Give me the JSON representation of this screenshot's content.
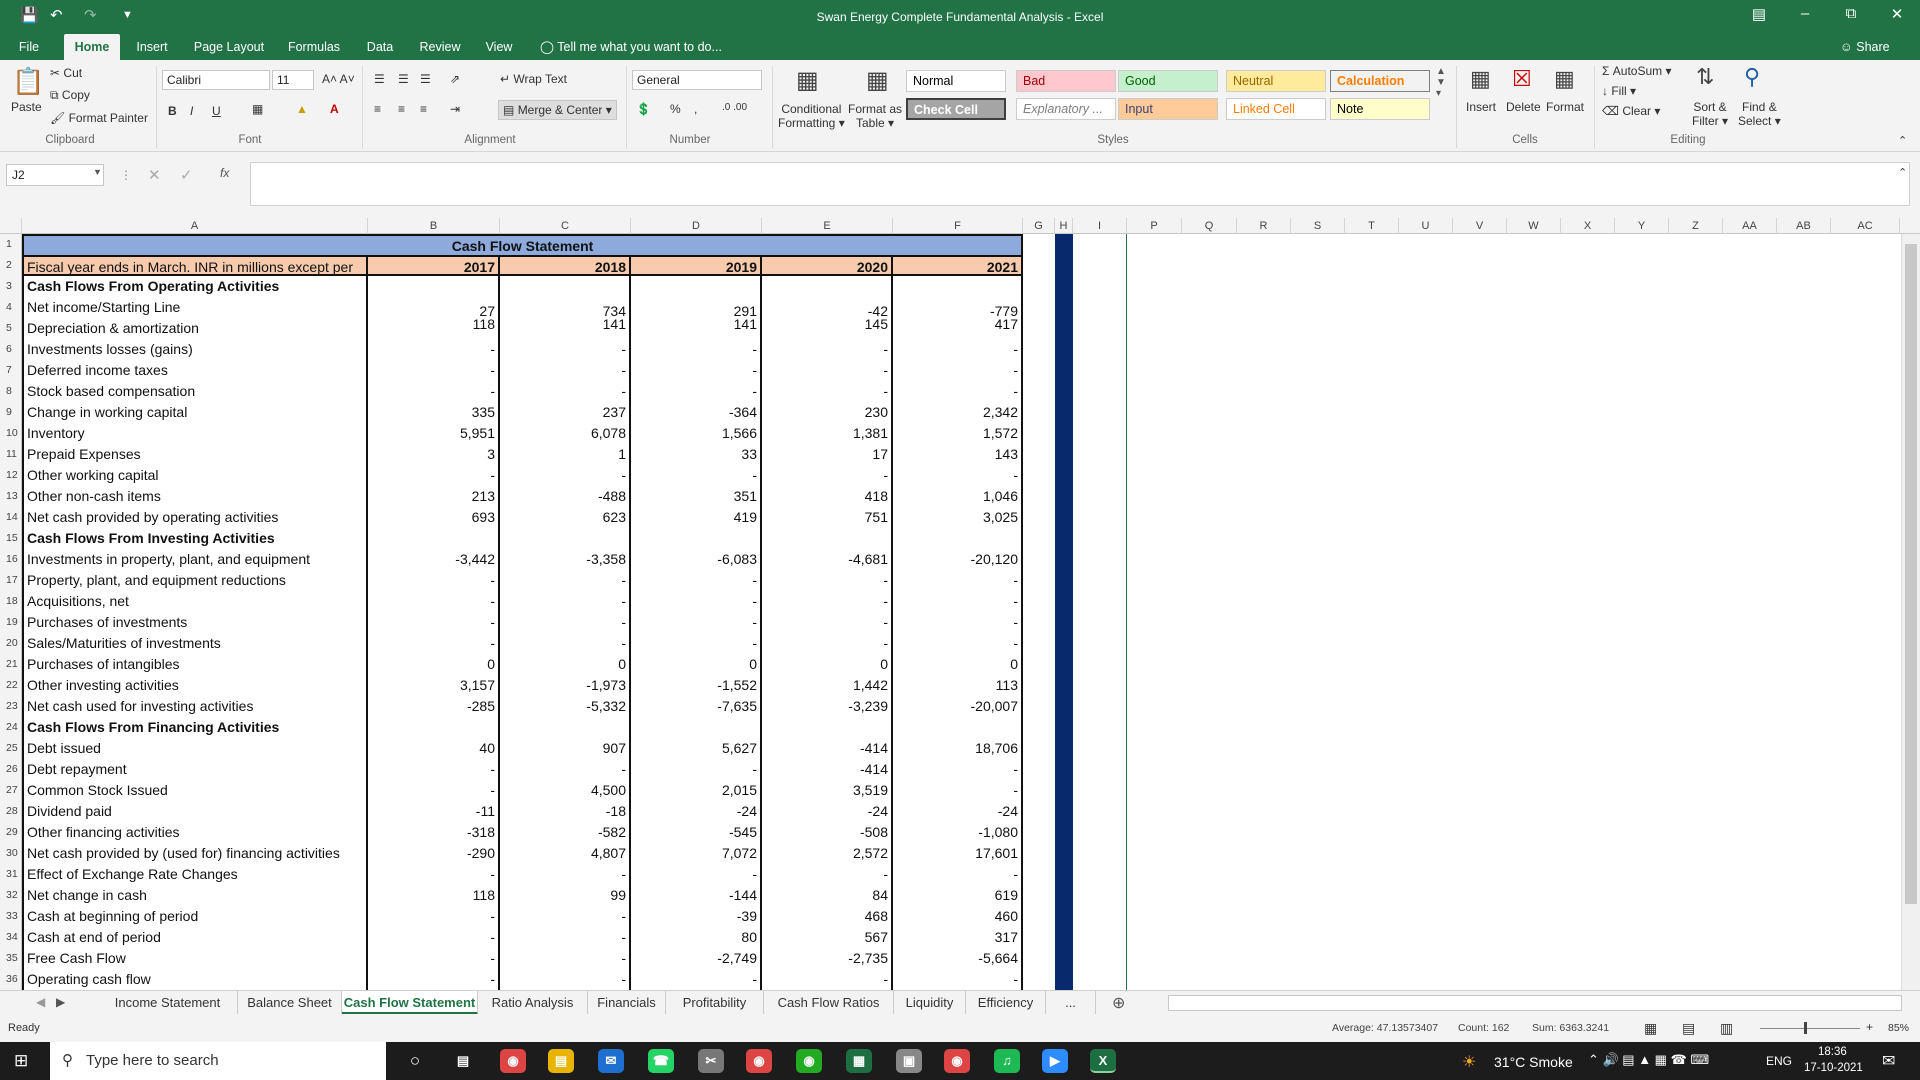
{
  "app": {
    "title": "Swan Energy Complete Fundamental Analysis - Excel",
    "share": "Share",
    "tell_me": "Tell me what you want to do..."
  },
  "menu": [
    "File",
    "Home",
    "Insert",
    "Page Layout",
    "Formulas",
    "Data",
    "Review",
    "View"
  ],
  "ribbon": {
    "paste": "Paste",
    "cut": "Cut",
    "copy": "Copy",
    "format_painter": "Format Painter",
    "clipboard": "Clipboard",
    "font_name": "Calibri",
    "font_size": "11",
    "font_group": "Font",
    "wrap_text": "Wrap Text",
    "merge_center": "Merge & Center",
    "alignment": "Alignment",
    "number_format": "General",
    "number": "Number",
    "conditional": "Conditional",
    "formatting": "Formatting",
    "format_as": "Format as",
    "table": "Table",
    "styles_group": "Styles",
    "styles": [
      {
        "label": "Normal",
        "bg": "#ffffff",
        "fg": "#000000"
      },
      {
        "label": "Bad",
        "bg": "#ffc7ce",
        "fg": "#9c0006"
      },
      {
        "label": "Good",
        "bg": "#c6efce",
        "fg": "#006100"
      },
      {
        "label": "Neutral",
        "bg": "#ffeb9c",
        "fg": "#9c6500"
      },
      {
        "label": "Calculation",
        "bg": "#f2f2f2",
        "fg": "#fa7d00"
      },
      {
        "label": "Check Cell",
        "bg": "#a5a5a5",
        "fg": "#ffffff"
      },
      {
        "label": "Explanatory ...",
        "bg": "#ffffff",
        "fg": "#7f7f7f"
      },
      {
        "label": "Input",
        "bg": "#ffcc99",
        "fg": "#3f3f76"
      },
      {
        "label": "Linked Cell",
        "bg": "#ffffff",
        "fg": "#fa7d00"
      },
      {
        "label": "Note",
        "bg": "#ffffcc",
        "fg": "#000000"
      }
    ],
    "insert": "Insert",
    "delete": "Delete",
    "format": "Format",
    "cells": "Cells",
    "autosum": "AutoSum",
    "fill": "Fill",
    "clear": "Clear",
    "sort": "Sort &",
    "filter": "Filter",
    "find": "Find &",
    "select": "Select",
    "editing": "Editing"
  },
  "formula_bar": {
    "name_box": "J2",
    "fx": "fx",
    "value": ""
  },
  "columns": [
    "A",
    "B",
    "C",
    "D",
    "E",
    "F",
    "G",
    "H",
    "I",
    "P",
    "Q",
    "R",
    "S",
    "T",
    "U",
    "V",
    "W",
    "X",
    "Y",
    "Z",
    "AA",
    "AB",
    "AC"
  ],
  "sheet": {
    "title": "Cash Flow Statement",
    "header_label": "Fiscal year ends in March. INR in millions except per",
    "years": [
      "2017",
      "2018",
      "2019",
      "2020",
      "2021"
    ],
    "rows": [
      {
        "n": "3",
        "label": "Cash Flows From Operating Activities",
        "bold": true,
        "v": [
          "",
          "",
          "",
          "",
          ""
        ]
      },
      {
        "n": "4",
        "label": "Net income/Starting Line",
        "v": [
          "27",
          "734",
          "291",
          "-42",
          "-779"
        ]
      },
      {
        "n": "5",
        "label": "Depreciation & amortization",
        "v": [
          "118",
          "141",
          "141",
          "145",
          "417"
        ]
      },
      {
        "n": "6",
        "label": "Investments losses (gains)",
        "v": [
          "-",
          "-",
          "-",
          "-",
          "-"
        ]
      },
      {
        "n": "7",
        "label": "Deferred income taxes",
        "v": [
          "-",
          "-",
          "-",
          "-",
          "-"
        ]
      },
      {
        "n": "8",
        "label": "Stock based compensation",
        "v": [
          "-",
          "-",
          "-",
          "-",
          "-"
        ]
      },
      {
        "n": "9",
        "label": "Change in working capital",
        "v": [
          "335",
          "237",
          "-364",
          "230",
          "2,342"
        ]
      },
      {
        "n": "10",
        "label": "Inventory",
        "v": [
          "5,951",
          "6,078",
          "1,566",
          "1,381",
          "1,572"
        ]
      },
      {
        "n": "11",
        "label": "Prepaid Expenses",
        "v": [
          "3",
          "1",
          "33",
          "17",
          "143"
        ]
      },
      {
        "n": "12",
        "label": "Other working capital",
        "v": [
          "-",
          "-",
          "-",
          "-",
          "-"
        ]
      },
      {
        "n": "13",
        "label": "Other non-cash items",
        "v": [
          "213",
          "-488",
          "351",
          "418",
          "1,046"
        ]
      },
      {
        "n": "14",
        "label": "Net cash provided by operating activities",
        "v": [
          "693",
          "623",
          "419",
          "751",
          "3,025"
        ]
      },
      {
        "n": "15",
        "label": "Cash Flows From Investing Activities",
        "bold": true,
        "v": [
          "",
          "",
          "",
          "",
          ""
        ]
      },
      {
        "n": "16",
        "label": "Investments in property, plant, and equipment",
        "v": [
          "-3,442",
          "-3,358",
          "-6,083",
          "-4,681",
          "-20,120"
        ]
      },
      {
        "n": "17",
        "label": "Property, plant, and equipment reductions",
        "v": [
          "-",
          "-",
          "-",
          "-",
          "-"
        ]
      },
      {
        "n": "18",
        "label": "Acquisitions, net",
        "v": [
          "-",
          "-",
          "-",
          "-",
          "-"
        ]
      },
      {
        "n": "19",
        "label": "Purchases of investments",
        "v": [
          "-",
          "-",
          "-",
          "-",
          "-"
        ]
      },
      {
        "n": "20",
        "label": "Sales/Maturities of investments",
        "v": [
          "-",
          "-",
          "-",
          "-",
          "-"
        ]
      },
      {
        "n": "21",
        "label": "Purchases of intangibles",
        "v": [
          "0",
          "0",
          "0",
          "0",
          "0"
        ]
      },
      {
        "n": "22",
        "label": "Other investing activities",
        "v": [
          "3,157",
          "-1,973",
          "-1,552",
          "1,442",
          "113"
        ]
      },
      {
        "n": "23",
        "label": "Net cash used for investing activities",
        "v": [
          "-285",
          "-5,332",
          "-7,635",
          "-3,239",
          "-20,007"
        ]
      },
      {
        "n": "24",
        "label": "Cash Flows From Financing Activities",
        "bold": true,
        "v": [
          "",
          "",
          "",
          "",
          ""
        ]
      },
      {
        "n": "25",
        "label": "Debt issued",
        "v": [
          "40",
          "907",
          "5,627",
          "-414",
          "18,706"
        ]
      },
      {
        "n": "26",
        "label": "Debt repayment",
        "v": [
          "-",
          "-",
          "-",
          "-414",
          "-"
        ]
      },
      {
        "n": "27",
        "label": "Common Stock Issued",
        "v": [
          "-",
          "4,500",
          "2,015",
          "3,519",
          "-"
        ]
      },
      {
        "n": "28",
        "label": "Dividend paid",
        "v": [
          "-11",
          "-18",
          "-24",
          "-24",
          "-24"
        ]
      },
      {
        "n": "29",
        "label": "Other financing activities",
        "v": [
          "-318",
          "-582",
          "-545",
          "-508",
          "-1,080"
        ]
      },
      {
        "n": "30",
        "label": "Net cash provided by (used for) financing activities",
        "v": [
          "-290",
          "4,807",
          "7,072",
          "2,572",
          "17,601"
        ]
      },
      {
        "n": "31",
        "label": "Effect of Exchange Rate Changes",
        "v": [
          "-",
          "-",
          "-",
          "-",
          "-"
        ]
      },
      {
        "n": "32",
        "label": "Net change in cash",
        "v": [
          "118",
          "99",
          "-144",
          "84",
          "619"
        ]
      },
      {
        "n": "33",
        "label": "Cash at beginning of period",
        "v": [
          "-",
          "-",
          "-39",
          "468",
          "460"
        ]
      },
      {
        "n": "34",
        "label": "Cash at end of period",
        "v": [
          "-",
          "-",
          "80",
          "567",
          "317"
        ]
      },
      {
        "n": "35",
        "label": "Free Cash Flow",
        "v": [
          "-",
          "-",
          "-2,749",
          "-2,735",
          "-5,664"
        ]
      },
      {
        "n": "36",
        "label": "Operating cash flow",
        "v": [
          "-",
          "-",
          "-",
          "-",
          "-"
        ]
      }
    ]
  },
  "sheet_tabs": [
    "Income Statement",
    "Balance Sheet",
    "Cash Flow Statement",
    "Ratio Analysis",
    "Financials",
    "Profitability",
    "Cash Flow Ratios",
    "Liquidity",
    "Efficiency",
    "..."
  ],
  "status": {
    "ready": "Ready",
    "average": "Average: 47.13573407",
    "count": "Count: 162",
    "sum": "Sum: 6363.3241",
    "zoom": "85%"
  },
  "taskbar": {
    "search": "Type here to search",
    "weather": "31°C  Smoke",
    "lang": "ENG",
    "time": "18:36",
    "date": "17-10-2021"
  }
}
